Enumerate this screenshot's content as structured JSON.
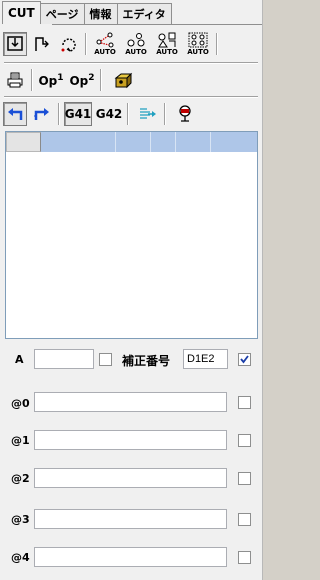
{
  "tabs": [
    {
      "label": "CUT",
      "active": true
    },
    {
      "label": "ページ",
      "active": false
    },
    {
      "label": "情報",
      "active": false
    },
    {
      "label": "エディタ",
      "active": false
    }
  ],
  "toolbar1": {
    "auto_labels": [
      "AUTO",
      "AUTO",
      "AUTO",
      "AUTO"
    ]
  },
  "toolbar2": {
    "op1_base": "Op",
    "op1_sup": "1",
    "op2_base": "Op",
    "op2_sup": "2"
  },
  "toolbar3": {
    "g41_label": "G41",
    "g42_label": "G42"
  },
  "form": {
    "a_label": "A",
    "a_value": "",
    "a_checked": false,
    "hosei_label": "補正番号",
    "hosei_value": "D1E2",
    "hosei_checked": true,
    "rows": [
      {
        "label": "@0",
        "value": "",
        "checked": false
      },
      {
        "label": "@1",
        "value": "",
        "checked": false
      },
      {
        "label": "@2",
        "value": "",
        "checked": false
      },
      {
        "label": "@3",
        "value": "",
        "checked": false
      },
      {
        "label": "@4",
        "value": "",
        "checked": false
      }
    ]
  },
  "colors": {
    "list_header": "#aec6e8",
    "selected_arrow": "#1a4fd6",
    "pressed_btn_bg": "#e6e6e6"
  }
}
